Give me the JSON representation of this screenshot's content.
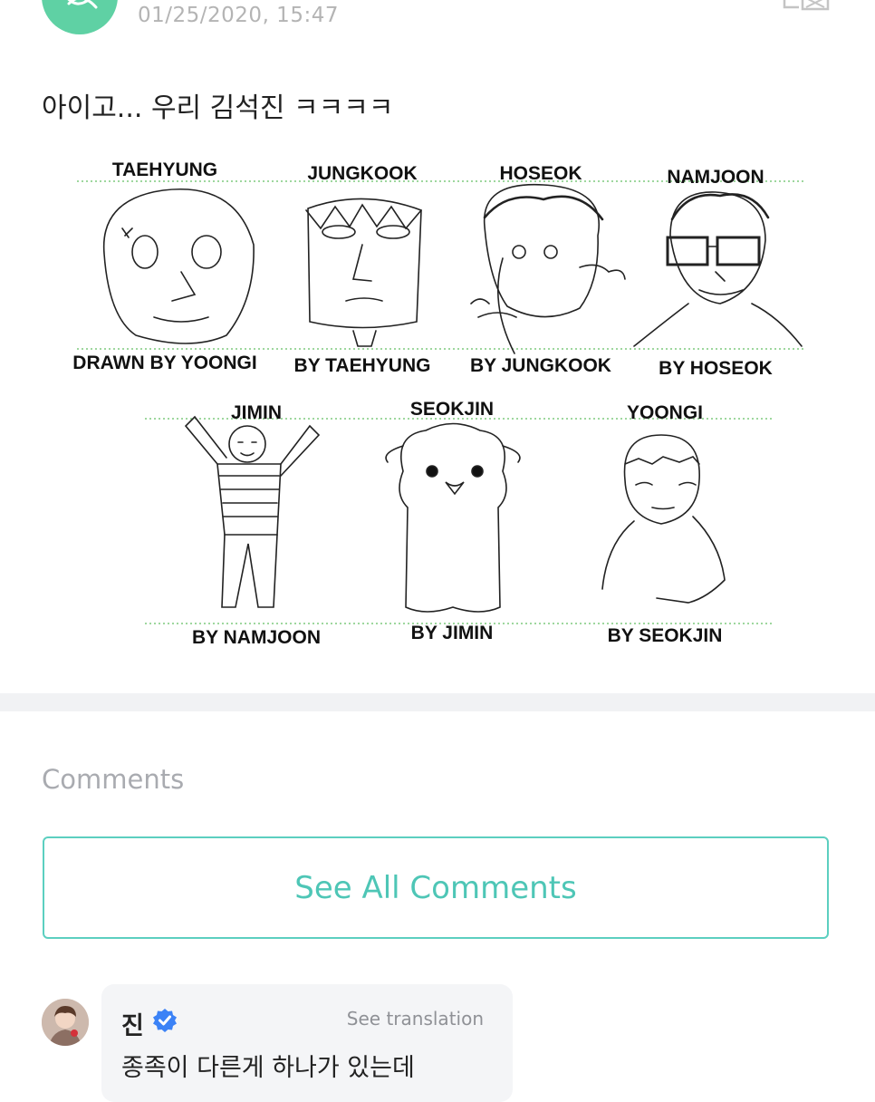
{
  "post": {
    "timestamp": "01/25/2020, 15:47",
    "text": "아이고... 우리 김석진 ㅋㅋㅋㅋ"
  },
  "drawings": {
    "top_row": [
      {
        "name": "TAEHYUNG",
        "artist": "DRAWN BY YOONGI"
      },
      {
        "name": "JUNGKOOK",
        "artist": "BY TAEHYUNG"
      },
      {
        "name": "HOSEOK",
        "artist": "BY JUNGKOOK"
      },
      {
        "name": "NAMJOON",
        "artist": "BY HOSEOK"
      }
    ],
    "bottom_row": [
      {
        "name": "JIMIN",
        "artist": "BY NAMJOON"
      },
      {
        "name": "SEOKJIN",
        "artist": "BY JIMIN"
      },
      {
        "name": "YOONGI",
        "artist": "BY SEOKJIN"
      }
    ]
  },
  "comments": {
    "heading": "Comments",
    "see_all_label": "See All Comments",
    "items": [
      {
        "author": "진",
        "see_translation": "See translation",
        "text": "종족이 다른게 하나가 있는데"
      }
    ]
  },
  "colors": {
    "accent": "#4ec6b6",
    "avatar_green": "#5fd1a4",
    "verified": "#3b82f6"
  },
  "icons": [
    "app-logo-icon",
    "share-icon",
    "verified-badge-icon"
  ]
}
